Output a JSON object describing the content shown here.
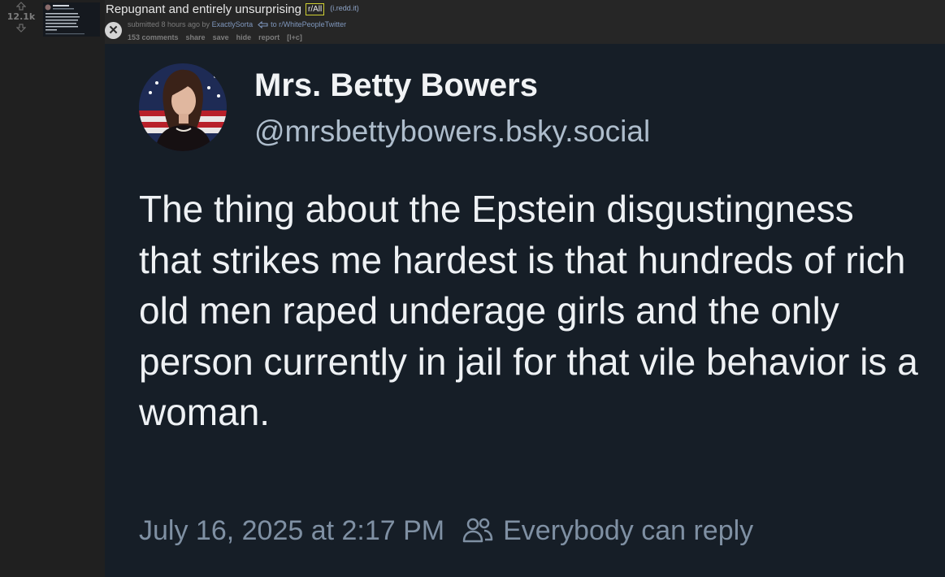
{
  "post": {
    "score": "12.1k",
    "title": "Repugnant and entirely unsurprising",
    "subreddit_badge": "r/All",
    "domain": "(i.redd.it)",
    "submitted_prefix": "submitted 8 hours ago by",
    "author": "ExactlySorta",
    "crosspost_to": "to r/WhitePeopleTwitter",
    "buttons": [
      "153 comments",
      "share",
      "save",
      "hide",
      "report",
      "[l+c]"
    ]
  },
  "tweet": {
    "display_name": "Mrs. Betty Bowers",
    "handle": "@mrsbettybowers.bsky.social",
    "text": "The thing about the Epstein disgustingness that strikes me hardest is that hundreds of rich old men raped underage girls and the only person currently in jail for that vile behavior is a woman.",
    "timestamp": "July 16, 2025 at 2:17 PM",
    "reply_setting": "Everybody can reply"
  },
  "icons": {
    "upvote": "upvote-arrow-icon",
    "downvote": "downvote-arrow-icon",
    "close": "close-icon",
    "crosspost": "crosspost-icon",
    "people": "people-icon"
  },
  "colors": {
    "page_bg": "#1c1c1c",
    "tweet_bg": "#161e27",
    "subreddit_badge_border": "#cfcf32",
    "link": "#7f97bd"
  }
}
